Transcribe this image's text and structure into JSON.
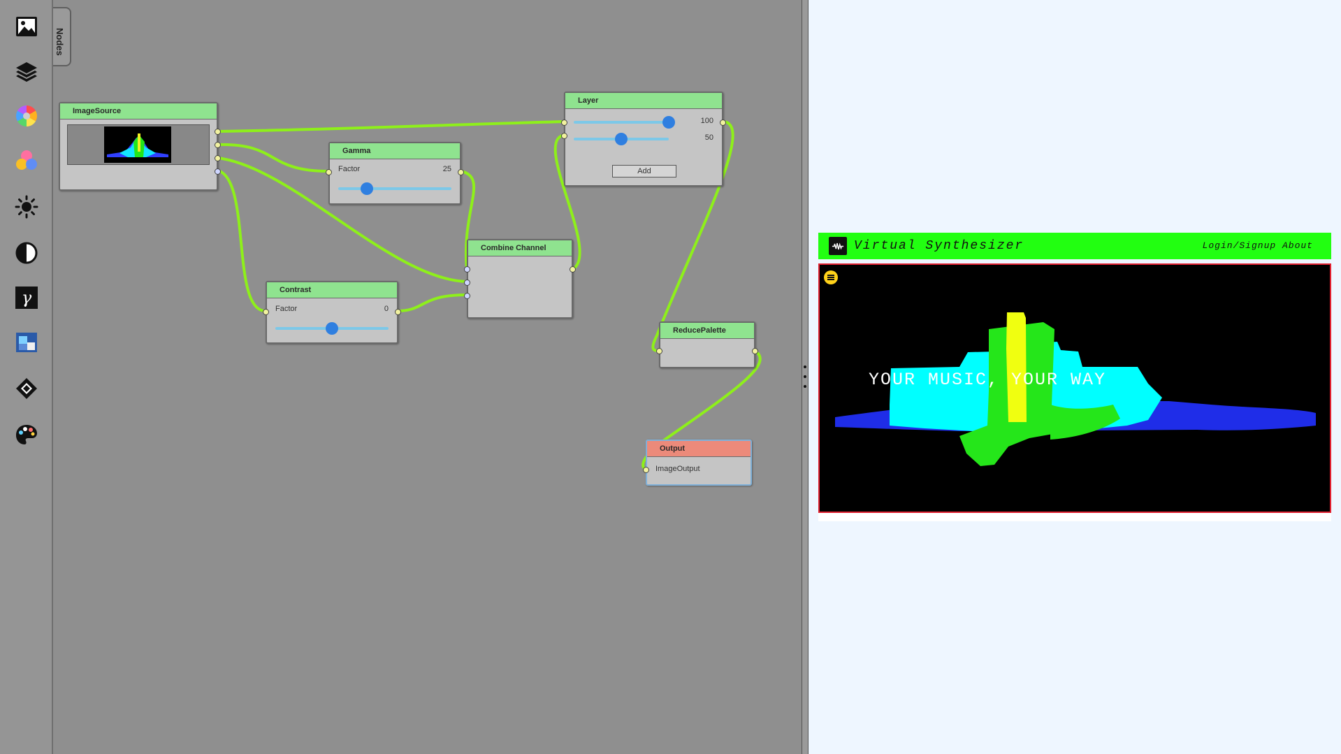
{
  "toolbar": {
    "tools": [
      {
        "name": "image-source-tool",
        "icon": "image-icon"
      },
      {
        "name": "layer-tool",
        "icon": "layers-icon"
      },
      {
        "name": "color-wheel-tool",
        "icon": "color-wheel-icon"
      },
      {
        "name": "combine-channel-tool",
        "icon": "rgb-circles-icon"
      },
      {
        "name": "brightness-tool",
        "icon": "sun-icon"
      },
      {
        "name": "contrast-tool",
        "icon": "contrast-icon"
      },
      {
        "name": "gamma-tool",
        "icon": "gamma-icon",
        "glyph": "γ"
      },
      {
        "name": "reduce-palette-tool",
        "icon": "palette-swatch-icon"
      },
      {
        "name": "transform-tool",
        "icon": "diamond-icon"
      },
      {
        "name": "palette-tool",
        "icon": "paint-palette-icon"
      }
    ],
    "nodes_tab": "Nodes"
  },
  "nodes": {
    "image_source": {
      "title": "ImageSource"
    },
    "gamma": {
      "title": "Gamma",
      "factor_label": "Factor",
      "factor_value": "25",
      "factor_fraction": 0.25
    },
    "contrast": {
      "title": "Contrast",
      "factor_label": "Factor",
      "factor_value": "0",
      "factor_fraction": 0.5
    },
    "combine": {
      "title": "Combine Channel"
    },
    "layer": {
      "title": "Layer",
      "slider1_value": "100",
      "slider1_fraction": 1.0,
      "slider2_value": "50",
      "slider2_fraction": 0.5,
      "add_label": "Add"
    },
    "reduce": {
      "title": "ReducePalette"
    },
    "output": {
      "title": "Output",
      "port_label": "ImageOutput"
    }
  },
  "colors": {
    "node_header": "#8fe38f",
    "output_header": "#ec8a7a",
    "wire": "#8ef01a",
    "site_header": "#22ff11",
    "stage_border": "#e02030"
  },
  "preview": {
    "site_title": "Virtual Synthesizer",
    "nav": "Login/Signup  About",
    "hero": "YOUR MUSIC, YOUR WAY"
  }
}
